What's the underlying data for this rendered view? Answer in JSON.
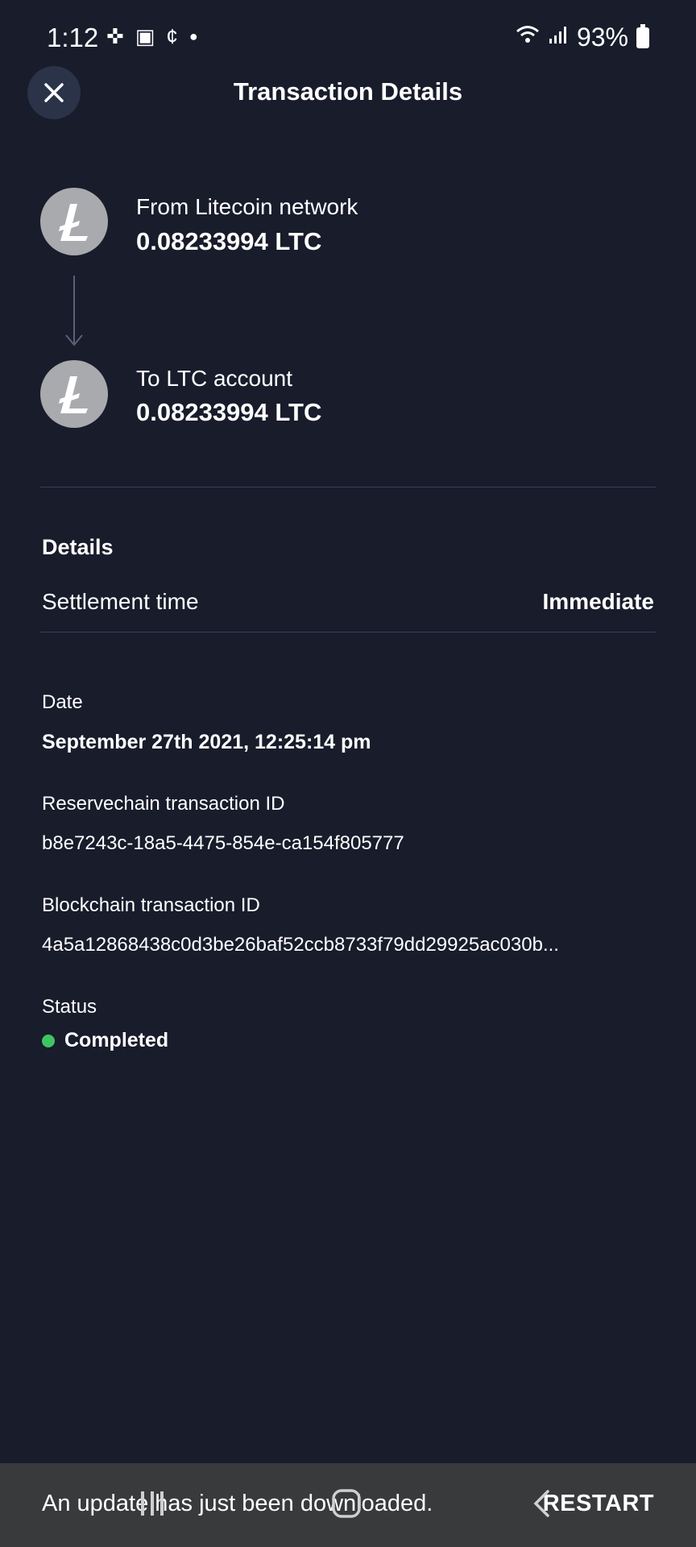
{
  "status_bar": {
    "time": "1:12",
    "battery": "93%",
    "icons": [
      "game-icon",
      "gallery-icon",
      "cent-icon",
      "dot-icon",
      "wifi-icon",
      "signal-icon",
      "battery-icon"
    ]
  },
  "header": {
    "title": "Transaction Details",
    "close_icon": "close-icon"
  },
  "transfer": {
    "from": {
      "label": "From Litecoin network",
      "amount": "0.08233994 LTC",
      "icon": "litecoin-icon"
    },
    "to": {
      "label": "To LTC account",
      "amount": "0.08233994 LTC",
      "icon": "litecoin-icon"
    }
  },
  "details": {
    "section_title": "Details",
    "settlement_label": "Settlement time",
    "settlement_value": "Immediate",
    "date_label": "Date",
    "date_value": "September 27th 2021, 12:25:14 pm",
    "reservechain_label": "Reservechain transaction ID",
    "reservechain_value": "b8e7243c-18a5-4475-854e-ca154f805777",
    "blockchain_label": "Blockchain transaction ID",
    "blockchain_value": "4a5a12868438c0d3be26baf52ccb8733f79dd29925ac030b...",
    "status_label": "Status",
    "status_value": "Completed",
    "status_color": "#3fc463"
  },
  "snackbar": {
    "message": "An update has just been downloaded.",
    "action": "RESTART"
  },
  "colors": {
    "background": "#181c2b",
    "close_button": "#2b3349",
    "coin": "#a9aaae",
    "divider": "#39405a",
    "snackbar": "#393a3c"
  }
}
